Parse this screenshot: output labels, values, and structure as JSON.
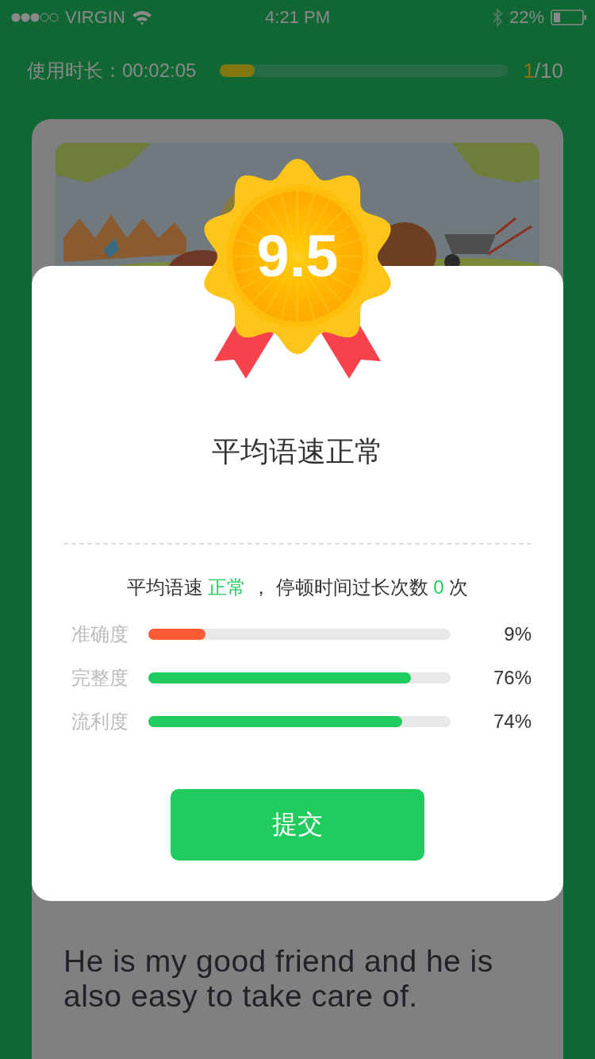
{
  "status_bar": {
    "carrier": "VIRGIN",
    "time": "4:21 PM",
    "battery": "22%"
  },
  "session": {
    "label": "使用时长：",
    "elapsed": "00:02:05",
    "level": 0.12,
    "current": "1",
    "total": "/10"
  },
  "lesson": {
    "sentence": "He is my good friend and he is also easy to take care of."
  },
  "result": {
    "score": "9.5",
    "title": "平均语速正常",
    "summary": [
      {
        "text": "平均语速 ",
        "highlight": false
      },
      {
        "text": "正常",
        "highlight": true
      },
      {
        "text": " ， 停顿时间过长次数 ",
        "highlight": false
      },
      {
        "text": "0",
        "highlight": true
      },
      {
        "text": " 次",
        "highlight": false
      }
    ],
    "metrics": [
      {
        "label": "准确度",
        "level": 0.19,
        "value": "9%",
        "color": "#ff5c35"
      },
      {
        "label": "完整度",
        "level": 0.87,
        "value": "76%",
        "color": "#21cc5f"
      },
      {
        "label": "流利度",
        "level": 0.84,
        "value": "74%",
        "color": "#21cc5f"
      }
    ],
    "submit": "提交"
  }
}
